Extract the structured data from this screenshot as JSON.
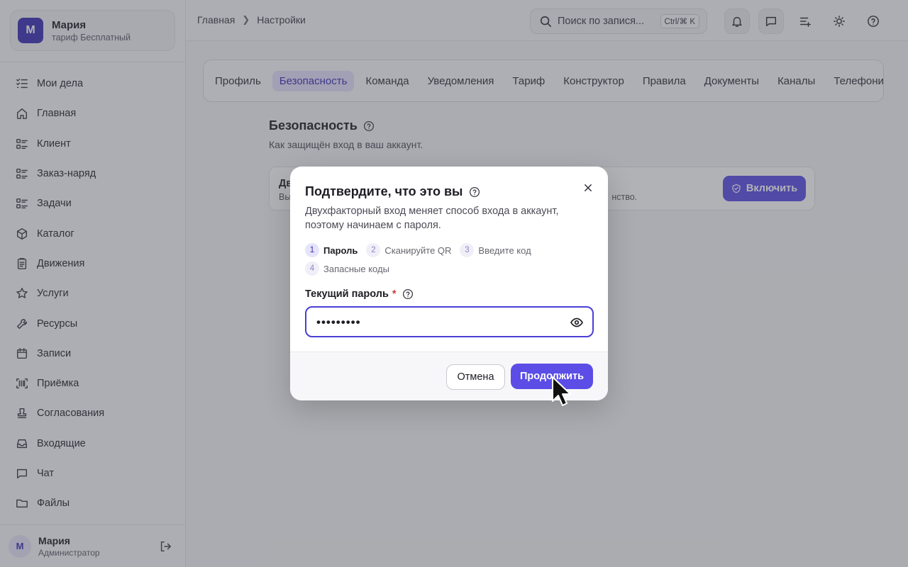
{
  "org": {
    "avatar": "М",
    "name": "Мария",
    "plan": "тариф Бесплатный"
  },
  "sidebar": {
    "items": [
      {
        "label": "Мои дела",
        "icon": "checklist-icon"
      },
      {
        "label": "Главная",
        "icon": "home-icon"
      },
      {
        "label": "Клиент",
        "icon": "list-icon"
      },
      {
        "label": "Заказ-наряд",
        "icon": "list-icon"
      },
      {
        "label": "Задачи",
        "icon": "list-icon"
      },
      {
        "label": "Каталог",
        "icon": "box-icon"
      },
      {
        "label": "Движения",
        "icon": "clipboard-icon"
      },
      {
        "label": "Услуги",
        "icon": "star-icon"
      },
      {
        "label": "Ресурсы",
        "icon": "wrench-icon"
      },
      {
        "label": "Записи",
        "icon": "calendar-icon"
      },
      {
        "label": "Приёмка",
        "icon": "scan-icon"
      },
      {
        "label": "Согласования",
        "icon": "stamp-icon"
      },
      {
        "label": "Входящие",
        "icon": "inbox-icon"
      },
      {
        "label": "Чат",
        "icon": "chat-icon"
      },
      {
        "label": "Файлы",
        "icon": "folder-icon"
      }
    ]
  },
  "user": {
    "avatar": "М",
    "name": "Мария",
    "role": "Администратор"
  },
  "header": {
    "breadcrumb": [
      "Главная",
      "Настройки"
    ],
    "search_placeholder": "Поиск по запися...",
    "search_shortcut": "Ctrl/⌘ K"
  },
  "tabs": [
    "Профиль",
    "Безопасность",
    "Команда",
    "Уведомления",
    "Тариф",
    "Конструктор",
    "Правила",
    "Документы",
    "Каналы",
    "Телефония"
  ],
  "active_tab": "Безопасность",
  "section": {
    "title": "Безопасность",
    "subtitle": "Как защищён вход в ваш аккаунт.",
    "card_title": "Дв",
    "card_desc_start": "Вы",
    "card_desc_end": "нство.",
    "enable_label": "Включить"
  },
  "modal": {
    "title": "Подтвердите, что это вы",
    "description": "Двухфакторный вход меняет способ входа в аккаунт, поэтому начинаем с пароля.",
    "steps": [
      {
        "num": "1",
        "label": "Пароль",
        "active": true
      },
      {
        "num": "2",
        "label": "Сканируйте QR",
        "active": false
      },
      {
        "num": "3",
        "label": "Введите код",
        "active": false
      },
      {
        "num": "4",
        "label": "Запасные коды",
        "active": false
      }
    ],
    "field_label": "Текущий пароль",
    "required_mark": "*",
    "password_value": "•••••••••",
    "cancel_label": "Отмена",
    "continue_label": "Продолжить"
  },
  "colors": {
    "accent": "#5b4de6",
    "accent_dark": "#3b2fb5",
    "required": "#d23a3a"
  }
}
